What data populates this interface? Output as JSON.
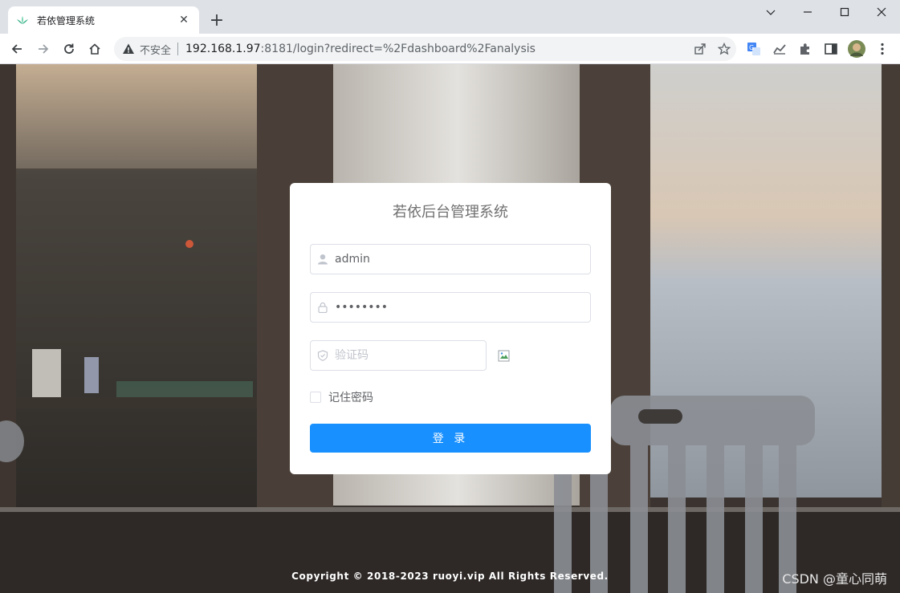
{
  "browser": {
    "tab_title": "若依管理系统",
    "tab_close": "✕",
    "new_tab": "+",
    "security_label": "不安全",
    "url_host": "192.168.1.97",
    "url_rest": ":8181/login?redirect=%2Fdashboard%2Fanalysis"
  },
  "login": {
    "title": "若依后台管理系统",
    "username_value": "admin",
    "password_value": "admin123",
    "captcha_placeholder": "验证码",
    "remember_label": "记住密码",
    "submit_label": "登 录"
  },
  "footer": {
    "copyright": "Copyright © 2018-2023 ruoyi.vip All Rights Reserved."
  },
  "watermark": "CSDN @童心同萌",
  "colors": {
    "primary": "#1890ff",
    "tab_bar": "#dee1e6"
  }
}
